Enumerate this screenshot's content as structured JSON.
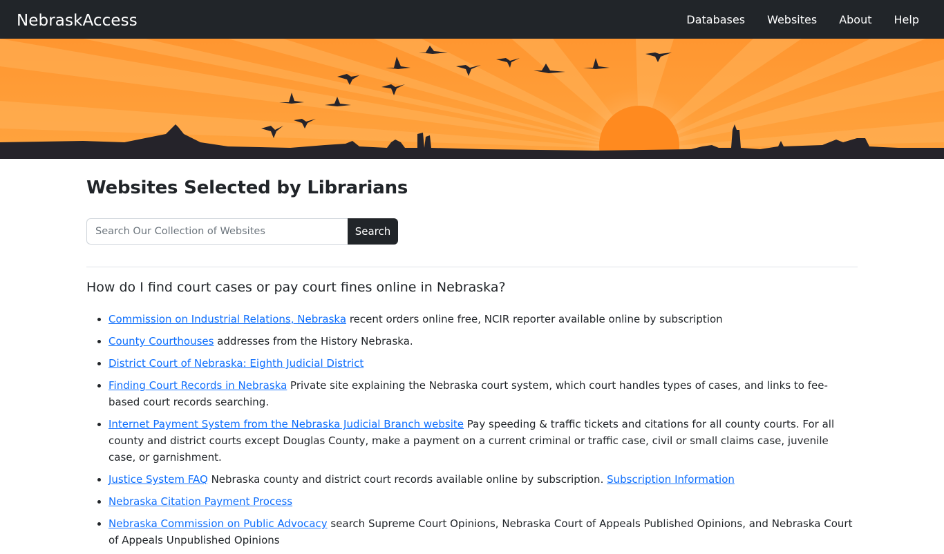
{
  "navbar": {
    "brand": "NebraskAccess",
    "links": [
      {
        "label": "Databases"
      },
      {
        "label": "Websites"
      },
      {
        "label": "About"
      },
      {
        "label": "Help"
      }
    ]
  },
  "colors": {
    "navbar_bg": "#212529",
    "link": "#0d6efd",
    "banner_orange": "#ff9a2e",
    "sun": "#ff8a1f"
  },
  "page": {
    "title": "Websites Selected by Librarians"
  },
  "search": {
    "placeholder": "Search Our Collection of Websites",
    "value": "",
    "button_label": "Search"
  },
  "question": "How do I find court cases or pay court fines online in Nebraska?",
  "results": [
    {
      "link": "Commission on Industrial Relations, Nebraska",
      "desc": " recent orders online free, NCIR reporter available online by subscription",
      "link2": "",
      "desc2": ""
    },
    {
      "link": "County Courthouses",
      "desc": " addresses from the History Nebraska.",
      "link2": "",
      "desc2": ""
    },
    {
      "link": "District Court of Nebraska: Eighth Judicial District",
      "desc": "",
      "link2": "",
      "desc2": ""
    },
    {
      "link": "Finding Court Records in Nebraska",
      "desc": " Private site explaining the Nebraska court system, which court handles types of cases, and links to fee-based court records searching.",
      "link2": "",
      "desc2": ""
    },
    {
      "link": "Internet Payment System from the Nebraska Judicial Branch website",
      "desc": " Pay speeding & traffic tickets and citations for all county courts. For all county and district courts except Douglas County, make a payment on a current criminal or traffic case, civil or small claims case, juvenile case, or garnishment.",
      "link2": "",
      "desc2": ""
    },
    {
      "link": "Justice System FAQ",
      "desc": " Nebraska county and district court records available online by subscription. ",
      "link2": "Subscription Information",
      "desc2": ""
    },
    {
      "link": "Nebraska Citation Payment Process",
      "desc": "",
      "link2": "",
      "desc2": ""
    },
    {
      "link": "Nebraska Commission on Public Advocacy",
      "desc": " search Supreme Court Opinions, Nebraska Court of Appeals Published Opinions, and Nebraska Court of Appeals Unpublished Opinions",
      "link2": "",
      "desc2": ""
    }
  ]
}
